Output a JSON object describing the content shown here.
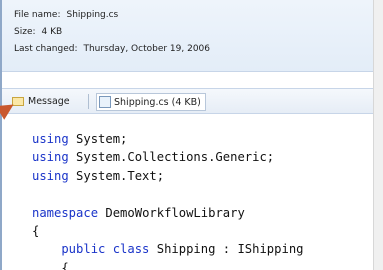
{
  "info": {
    "file_name_label": "File name:",
    "file_name_value": "Shipping.cs",
    "size_label": "Size:",
    "size_value": "4 KB",
    "last_changed_label": "Last changed:",
    "last_changed_value": "Thursday, October 19, 2006"
  },
  "tabs": {
    "message_label": "Message",
    "file_label": "Shipping.cs (4 KB)"
  },
  "code": {
    "lines": [
      {
        "kw": "using",
        "text": " System;"
      },
      {
        "kw": "using",
        "text": " System.Collections.Generic;"
      },
      {
        "kw": "using",
        "text": " System.Text;"
      },
      {
        "kw": "",
        "text": ""
      },
      {
        "kw": "namespace",
        "text": " DemoWorkflowLibrary"
      },
      {
        "kw": "",
        "text": "{"
      },
      {
        "kw": "    public class",
        "text": " Shipping : IShipping"
      },
      {
        "kw": "",
        "text": "    {"
      }
    ]
  },
  "colors": {
    "keyword": "#1a34c9",
    "info_panel_bg": "#e8f0fa",
    "arrow": "#c9582e"
  }
}
